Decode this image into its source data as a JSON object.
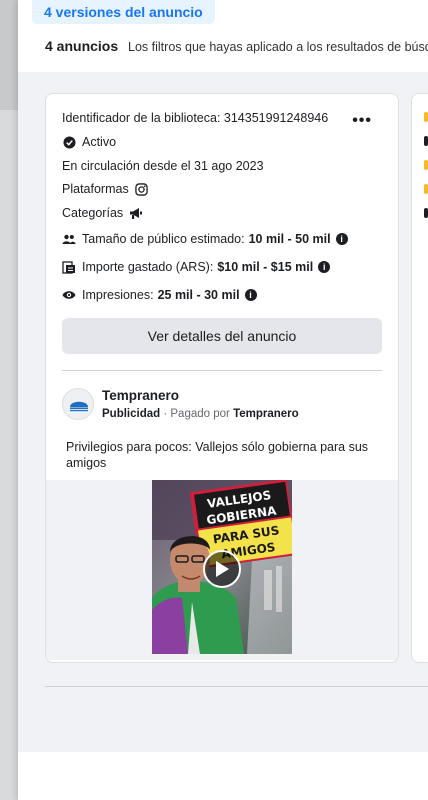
{
  "header": {
    "versions_tab": "4 versiones del anuncio",
    "ad_count": "4 anuncios",
    "filter_note": "Los filtros que hayas aplicado a los resultados de búsqueda"
  },
  "card": {
    "library_id_label": "Identificador de la biblioteca: 314351991248946",
    "status": "Activo",
    "running_since": "En circulación desde el 31 ago 2023",
    "platforms_label": "Plataformas",
    "categories_label": "Categorías",
    "audience_label": "Tamaño de público estimado:",
    "audience_value": "10 mil - 50 mil",
    "spend_label": "Importe gastado (ARS):",
    "spend_value": "$10 mil - $15 mil",
    "impressions_label": "Impresiones:",
    "impressions_value": "25 mil - 30 mil",
    "details_button": "Ver detalles del anuncio",
    "advertiser_name": "Tempranero",
    "sponsored_label": "Publicidad",
    "paid_by_prefix": "· Pagado por",
    "paid_by_name": "Tempranero",
    "ad_text": "Privilegios para pocos: Vallejos sólo gobierna para sus amigos",
    "media_caption_lines": [
      "VALLEJOS",
      "GOBIERNA",
      "PARA SUS",
      "AMIGOS"
    ]
  },
  "colors": {
    "accent": "#1877f2",
    "tab_bg": "#e7f3ff",
    "page_gray": "#f0f2f5",
    "button_gray": "#e4e6eb"
  }
}
